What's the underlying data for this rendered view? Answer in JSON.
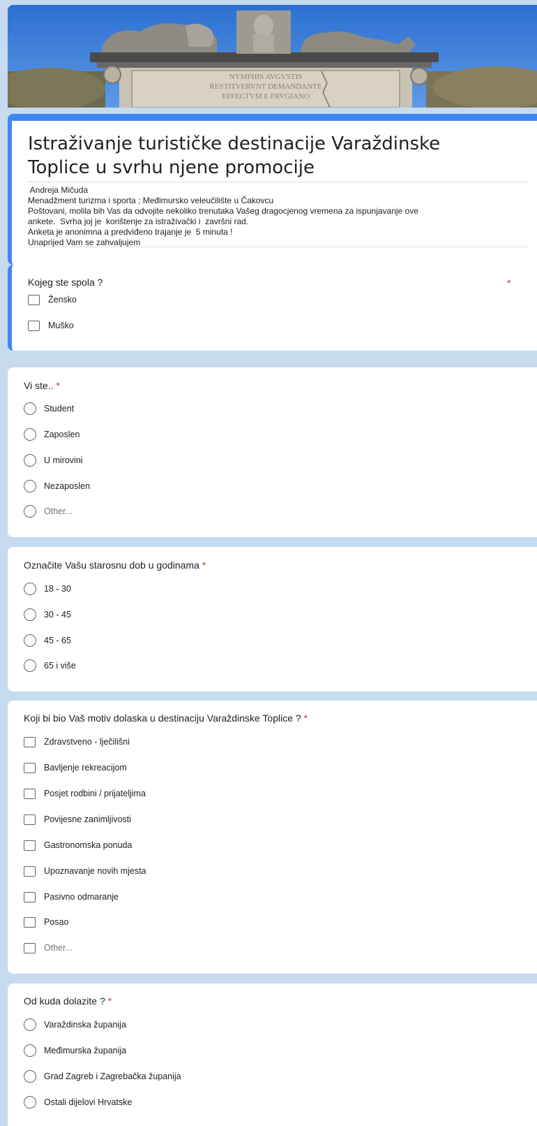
{
  "form": {
    "title_line1": "Istraživanje turističke destinacije Varaždinske",
    "title_line2": "Toplice u svrhu njene promocije",
    "description": [
      " Andreja Mičuda",
      "Menadžment turizma i sporta ; Međimursko veleučilište u Čakovcu",
      "Poštovani, molila bih Vas da odvojite nekoliko trenutaka Vašeg dragocjenog vremena za ispunjavanje ove",
      "ankete.  Svrha joj je  korištenje za istraživački i  završni rad.",
      "Anketa je anonimna a predviđeno trajanje je  5 minuta !",
      "Unaprijed Vam se zahvaljujem"
    ],
    "banner_inscription": [
      "NYMPHIS AVGVSTIS",
      "RESTITVERVNT DEMANDANTE",
      "EFFECTVM E FRVGIANO"
    ]
  },
  "required_marker": "*",
  "colors": {
    "accent": "#4285f4",
    "background": "#c6dbf0",
    "required": "#d93025"
  },
  "questions": [
    {
      "title": "Kojeg ste spola ?",
      "type": "checkbox",
      "options": [
        "Žensko",
        "Muško"
      ]
    },
    {
      "title": "Vi ste..",
      "type": "radio",
      "options": [
        "Student",
        "Zaposlen",
        "U mirovini",
        "Nezaposlen",
        "Other..."
      ]
    },
    {
      "title": "Označite Vašu starosnu dob u godinama",
      "type": "radio",
      "options": [
        "18 - 30",
        "30 - 45",
        "45 - 65",
        "65 i više"
      ]
    },
    {
      "title": "Koji bi bio  Vaš motiv dolaska u destinaciju Varaždinske Toplice ?",
      "type": "checkbox",
      "options": [
        "Zdravstveno - lječilišni",
        "Bavljenje rekreacijom",
        "Posjet rodbini / prijateljima",
        "Povijesne zanimljivosti",
        "Gastronomska ponuda",
        "Upoznavanje novih mjesta",
        "Pasivno odmaranje",
        "Posao",
        "Other..."
      ]
    },
    {
      "title": "Od kuda dolazite ?",
      "type": "radio",
      "options": [
        "Varaždinska županija",
        "Međimurska županija",
        "Grad Zagreb i Zagrebačka županija",
        "Ostali dijelovi Hrvatske"
      ]
    }
  ]
}
